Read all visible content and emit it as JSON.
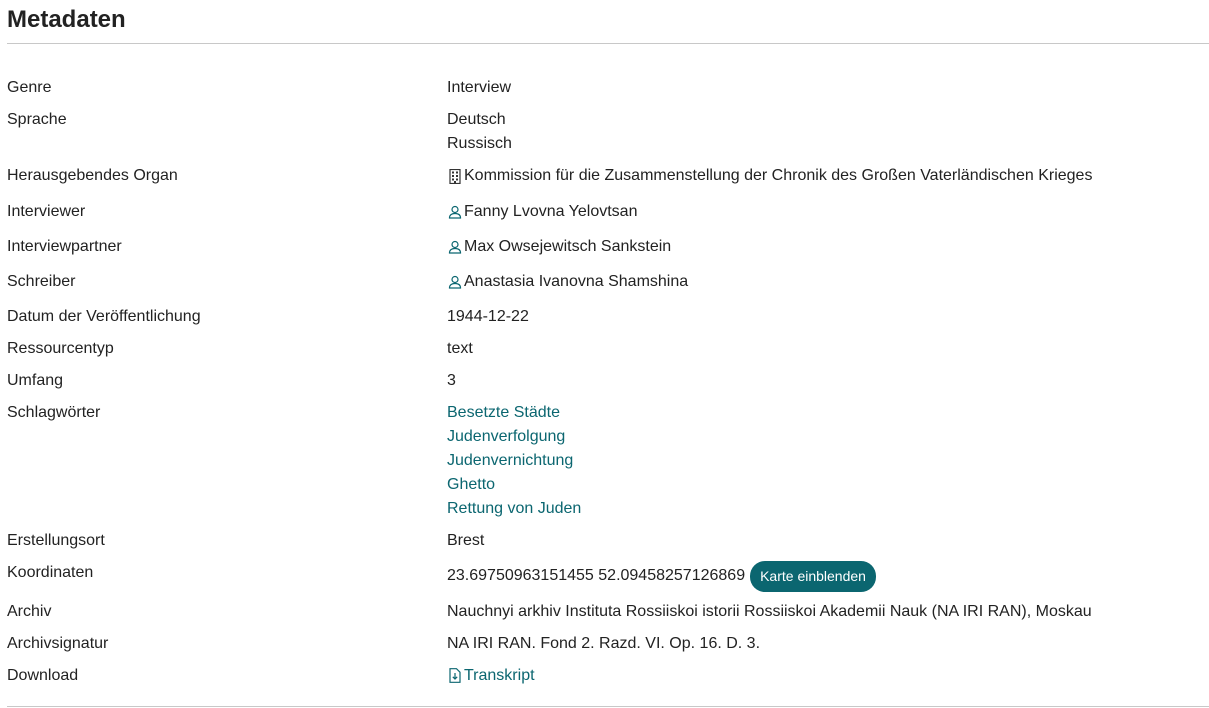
{
  "title": "Metadaten",
  "rows": {
    "genre": {
      "label": "Genre",
      "value": "Interview"
    },
    "sprache": {
      "label": "Sprache",
      "values": [
        "Deutsch",
        "Russisch"
      ]
    },
    "organ": {
      "label": "Herausgebendes Organ",
      "value": "Kommission für die Zusammenstellung der Chronik des Großen Vaterländischen Krieges",
      "icon": "building-icon"
    },
    "interviewer": {
      "label": "Interviewer",
      "value": "Fanny Lvovna Yelovtsan",
      "icon": "person-icon"
    },
    "partner": {
      "label": "Interviewpartner",
      "value": "Max Owsejewitsch Sankstein",
      "icon": "person-icon"
    },
    "schreiber": {
      "label": "Schreiber",
      "value": "Anastasia Ivanovna Shamshina",
      "icon": "person-icon"
    },
    "datum": {
      "label": "Datum der Veröffentlichung",
      "value": "1944-12-22"
    },
    "ressourcentyp": {
      "label": "Ressourcentyp",
      "value": "text"
    },
    "umfang": {
      "label": "Umfang",
      "value": "3"
    },
    "schlagwoerter": {
      "label": "Schlagwörter",
      "values": [
        "Besetzte Städte",
        "Judenverfolgung",
        "Judenvernichtung",
        "Ghetto",
        "Rettung von Juden"
      ]
    },
    "ort": {
      "label": "Erstellungsort",
      "value": "Brest"
    },
    "koordinaten": {
      "label": "Koordinaten",
      "value": "23.69750963151455 52.09458257126869",
      "button": "Karte einblenden"
    },
    "archiv": {
      "label": "Archiv",
      "value": "Nauchnyi arkhiv Instituta Rossiiskoi istorii Rossiiskoi Akademii Nauk (NA IRI RAN), Moskau"
    },
    "signatur": {
      "label": "Archivsignatur",
      "value": "NA IRI RAN. Fond 2. Razd. VI. Op. 16. D. 3."
    },
    "download": {
      "label": "Download",
      "value": "Transkript",
      "icon": "file-download-icon"
    }
  },
  "colors": {
    "link": "#0b6670",
    "button_bg": "#0b6670",
    "button_text": "#ffffff",
    "divider": "#c8c8c8"
  }
}
